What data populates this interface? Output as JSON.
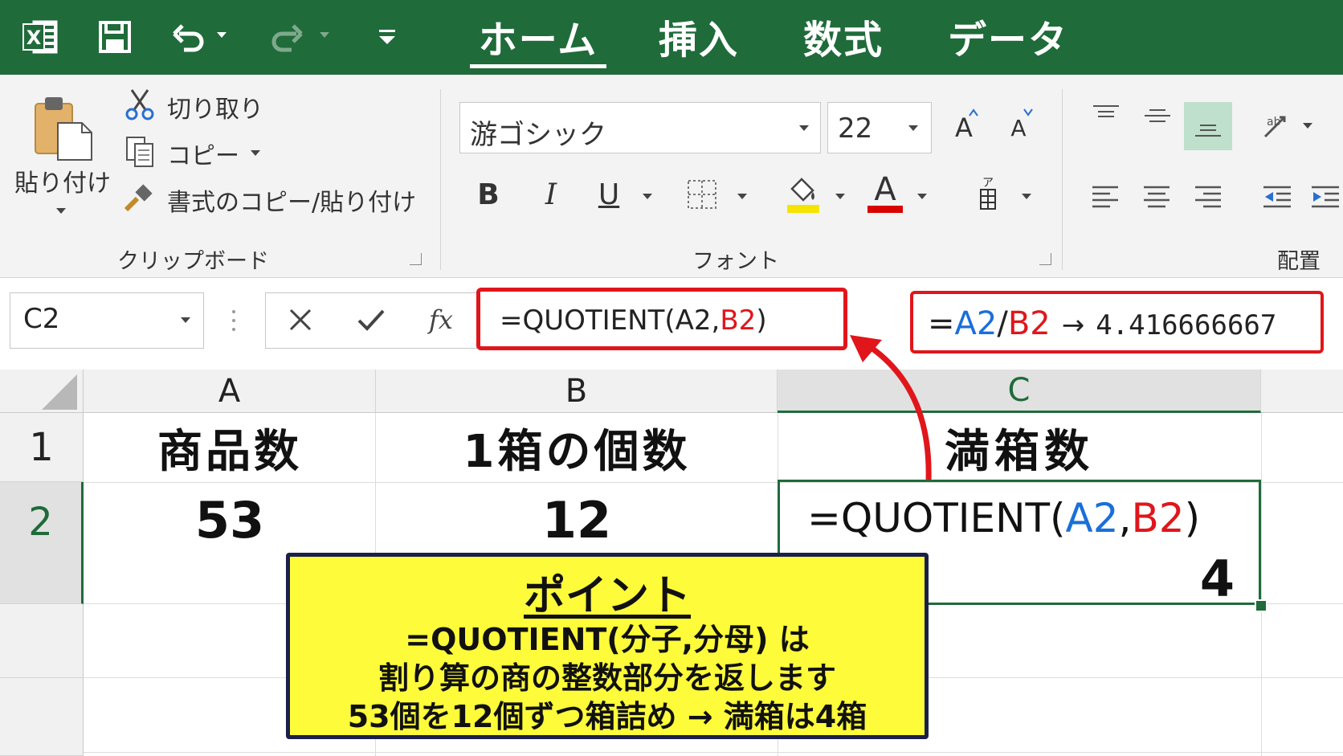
{
  "titlebar": {
    "tabs": [
      "ホーム",
      "挿入",
      "数式",
      "データ"
    ],
    "active_tab": "ホーム"
  },
  "clipboard": {
    "paste_label": "貼り付け",
    "cut_label": "切り取り",
    "copy_label": "コピー",
    "format_painter_label": "書式のコピー/貼り付け",
    "group_label": "クリップボード"
  },
  "font": {
    "font_name": "游ゴシック",
    "font_size": "22",
    "bold": "B",
    "italic": "I",
    "underline": "U",
    "font_color_letter": "A",
    "grow_letter": "A",
    "shrink_letter": "A",
    "group_label": "フォント"
  },
  "alignment": {
    "group_label": "配置"
  },
  "formula_bar": {
    "name_box": "C2",
    "fx": "fx",
    "formula_prefix": "=QUOTIENT(A2,",
    "formula_ref": "B2",
    "formula_suffix": ")"
  },
  "compare": {
    "eq": "=",
    "ref_a": "A2",
    "slash": "/",
    "ref_b": "B2",
    "arrow": "→",
    "value": "4.416666667"
  },
  "sheet": {
    "columns": [
      "A",
      "B",
      "C"
    ],
    "rows": [
      "1",
      "2"
    ],
    "a1": "商品数",
    "b1": "1箱の個数",
    "c1": "満箱数",
    "a2": "53",
    "b2": "12",
    "c2_formula_prefix": "=QUOTIENT(",
    "c2_ref_a": "A2",
    "c2_comma": ",",
    "c2_ref_b": "B2",
    "c2_suffix": ")",
    "c2_value": "4"
  },
  "point": {
    "title": "ポイント",
    "line1": "=QUOTIENT(分子,分母) は",
    "line2": "割り算の商の整数部分を返します",
    "line3": "53個を12個ずつ箱詰め → 満箱は4箱"
  },
  "colors": {
    "excel_green": "#1f6b3a",
    "highlight_red": "#e0161b",
    "ref_blue": "#1a6fd8",
    "callout_yellow": "#fdfb3a"
  }
}
